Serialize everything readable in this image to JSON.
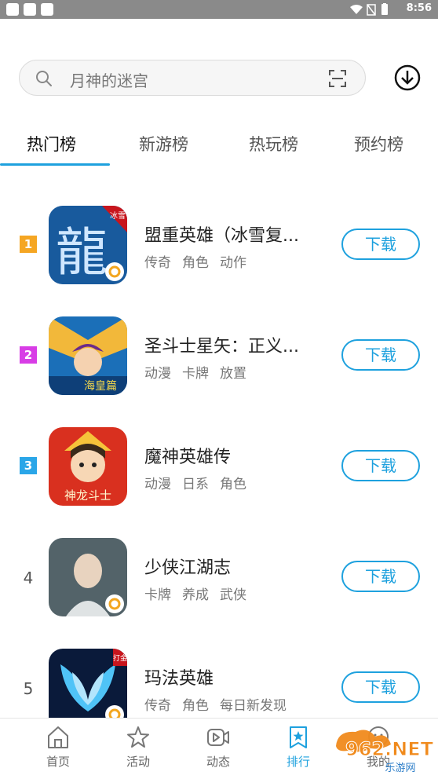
{
  "status_bar": {
    "time": "8:56"
  },
  "search": {
    "placeholder": "月神的迷宫"
  },
  "tabs": [
    {
      "label": "热门榜",
      "active": true
    },
    {
      "label": "新游榜",
      "active": false
    },
    {
      "label": "热玩榜",
      "active": false
    },
    {
      "label": "预约榜",
      "active": false
    }
  ],
  "games": [
    {
      "rank": "1",
      "title": "盟重英雄（冰雪复...",
      "tags": [
        "传奇",
        "角色",
        "动作"
      ],
      "button": "下载",
      "badge_color": "#f5a623"
    },
    {
      "rank": "2",
      "title": "圣斗士星矢：正义...",
      "tags": [
        "动漫",
        "卡牌",
        "放置"
      ],
      "button": "下载",
      "badge_color": "#d83de6"
    },
    {
      "rank": "3",
      "title": "魔神英雄传",
      "tags": [
        "动漫",
        "日系",
        "角色"
      ],
      "button": "下载",
      "badge_color": "#2aa6e8"
    },
    {
      "rank": "4",
      "title": "少侠江湖志",
      "tags": [
        "卡牌",
        "养成",
        "武侠"
      ],
      "button": "下载"
    },
    {
      "rank": "5",
      "title": "玛法英雄",
      "tags": [
        "传奇",
        "角色",
        "每日新发现"
      ],
      "button": "下载"
    }
  ],
  "icon_art_text": {
    "game1": "龍",
    "game1_corner": "冰雪",
    "game2": "海皇篇",
    "game3": "神龙斗士",
    "game5": "打金"
  },
  "bottom_nav": [
    {
      "label": "首页",
      "icon": "home-icon"
    },
    {
      "label": "活动",
      "icon": "star-icon"
    },
    {
      "label": "动态",
      "icon": "video-icon"
    },
    {
      "label": "排行",
      "icon": "ranking-icon",
      "active": true
    },
    {
      "label": "我的",
      "icon": "profile-icon"
    }
  ],
  "watermark": {
    "text": "962.NET",
    "subtext": "乐游网"
  },
  "colors": {
    "accent": "#1ea1de",
    "status_bar": "#8a8a8a"
  }
}
